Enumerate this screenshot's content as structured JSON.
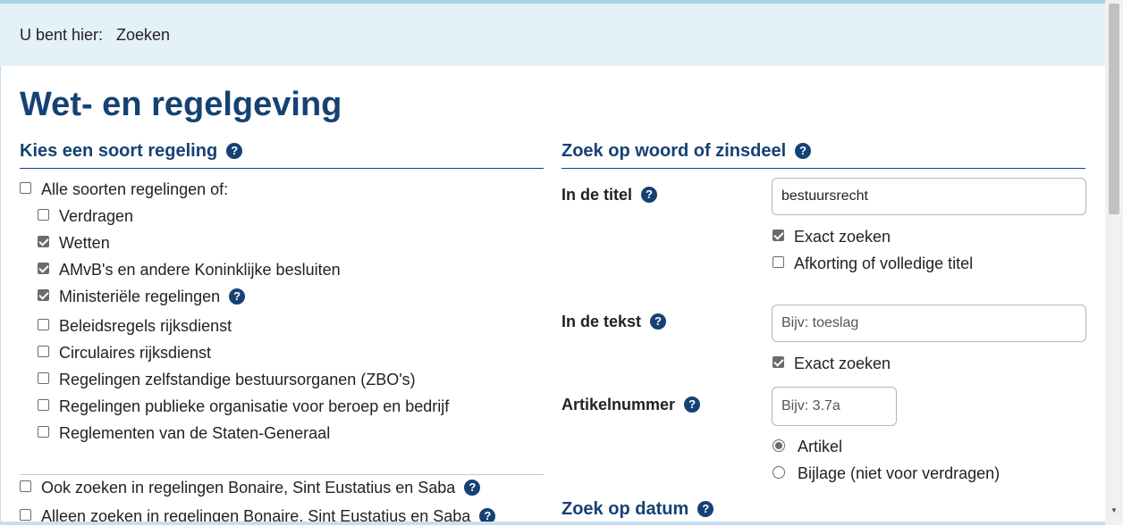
{
  "breadcrumb": {
    "label": "U bent hier:",
    "current": "Zoeken"
  },
  "page_title": "Wet- en regelgeving",
  "left": {
    "heading": "Kies een soort regeling",
    "all_label": "Alle soorten regelingen of:",
    "all_checked": false,
    "options": [
      {
        "label": "Verdragen",
        "checked": false,
        "help": false
      },
      {
        "label": "Wetten",
        "checked": true,
        "help": false
      },
      {
        "label": "AMvB's en andere Koninklijke besluiten",
        "checked": true,
        "help": false
      },
      {
        "label": "Ministeriële regelingen",
        "checked": true,
        "help": true
      },
      {
        "label": "Beleidsregels rijksdienst",
        "checked": false,
        "help": false
      },
      {
        "label": "Circulaires rijksdienst",
        "checked": false,
        "help": false
      },
      {
        "label": "Regelingen zelfstandige bestuursorganen (ZBO's)",
        "checked": false,
        "help": false
      },
      {
        "label": "Regelingen publieke organisatie voor beroep en bedrijf",
        "checked": false,
        "help": false
      },
      {
        "label": "Reglementen van de Staten-Generaal",
        "checked": false,
        "help": false
      }
    ],
    "bes_also": "Ook zoeken in regelingen Bonaire, Sint Eustatius en Saba",
    "bes_only": "Alleen zoeken in regelingen Bonaire, Sint Eustatius en Saba"
  },
  "right": {
    "heading": "Zoek op woord of zinsdeel",
    "title_label": "In de titel",
    "title_value": "bestuursrecht",
    "title_exact": "Exact zoeken",
    "title_exact_checked": true,
    "title_abbrev": "Afkorting of volledige titel",
    "title_abbrev_checked": false,
    "text_label": "In de tekst",
    "text_placeholder": "Bijv: toeslag",
    "text_exact": "Exact zoeken",
    "text_exact_checked": true,
    "article_label": "Artikelnummer",
    "article_placeholder": "Bijv: 3.7a",
    "radio_article": "Artikel",
    "radio_annex": "Bijlage (niet voor verdragen)",
    "date_heading": "Zoek op datum"
  },
  "help_glyph": "?",
  "colors": {
    "brand": "#154273",
    "breadcrumb_bg": "#e5f1f9"
  }
}
